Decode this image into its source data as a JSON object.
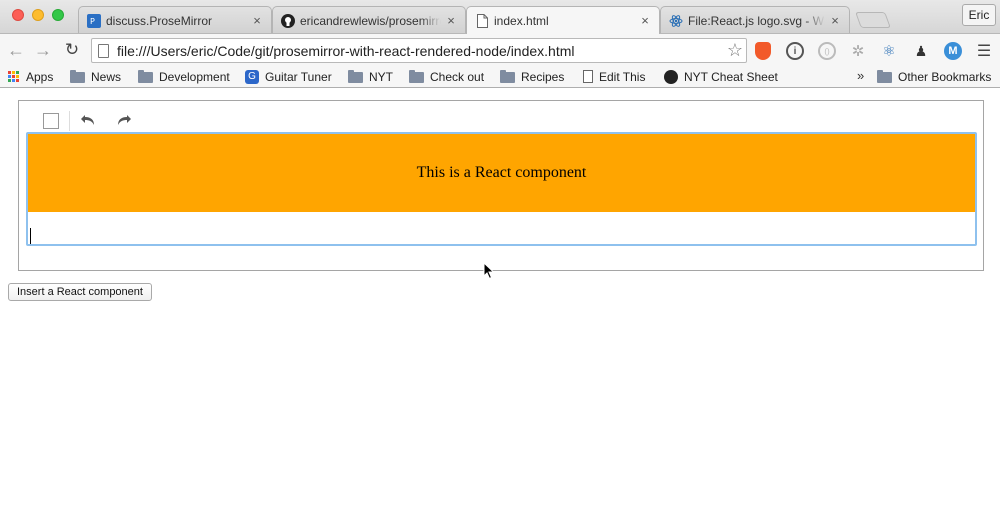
{
  "window": {
    "profile_name": "Eric"
  },
  "tabs": [
    {
      "title": "discuss.ProseMirror",
      "icon": "prosemirror-discuss-icon",
      "active": false
    },
    {
      "title": "ericandrewlewis/prosemirror",
      "icon": "github-icon",
      "active": false
    },
    {
      "title": "index.html",
      "icon": "page-icon",
      "active": true
    },
    {
      "title": "File:React.js logo.svg - Wiki",
      "icon": "react-icon",
      "active": false
    }
  ],
  "toolbar": {
    "url": "file:///Users/eric/Code/git/prosemirror-with-react-rendered-node/index.html"
  },
  "bookmarks": [
    {
      "label": "Apps",
      "icon": "apps-grid-icon"
    },
    {
      "label": "News",
      "icon": "folder-icon"
    },
    {
      "label": "Development",
      "icon": "folder-icon"
    },
    {
      "label": "Guitar Tuner",
      "icon": "guitar-tuner-icon"
    },
    {
      "label": "NYT",
      "icon": "folder-icon"
    },
    {
      "label": "Check out",
      "icon": "folder-icon"
    },
    {
      "label": "Recipes",
      "icon": "folder-icon"
    },
    {
      "label": "Edit This",
      "icon": "document-icon"
    },
    {
      "label": "NYT Cheat Sheet",
      "icon": "github-icon"
    }
  ],
  "bookmarks_overflow": "»",
  "other_bookmarks": "Other Bookmarks",
  "editor": {
    "react_component_text": "This is a React component"
  },
  "insert_button_label": "Insert a React component",
  "colors": {
    "react_node_bg": "#ffa500",
    "focus_outline": "#8ec1ee"
  }
}
